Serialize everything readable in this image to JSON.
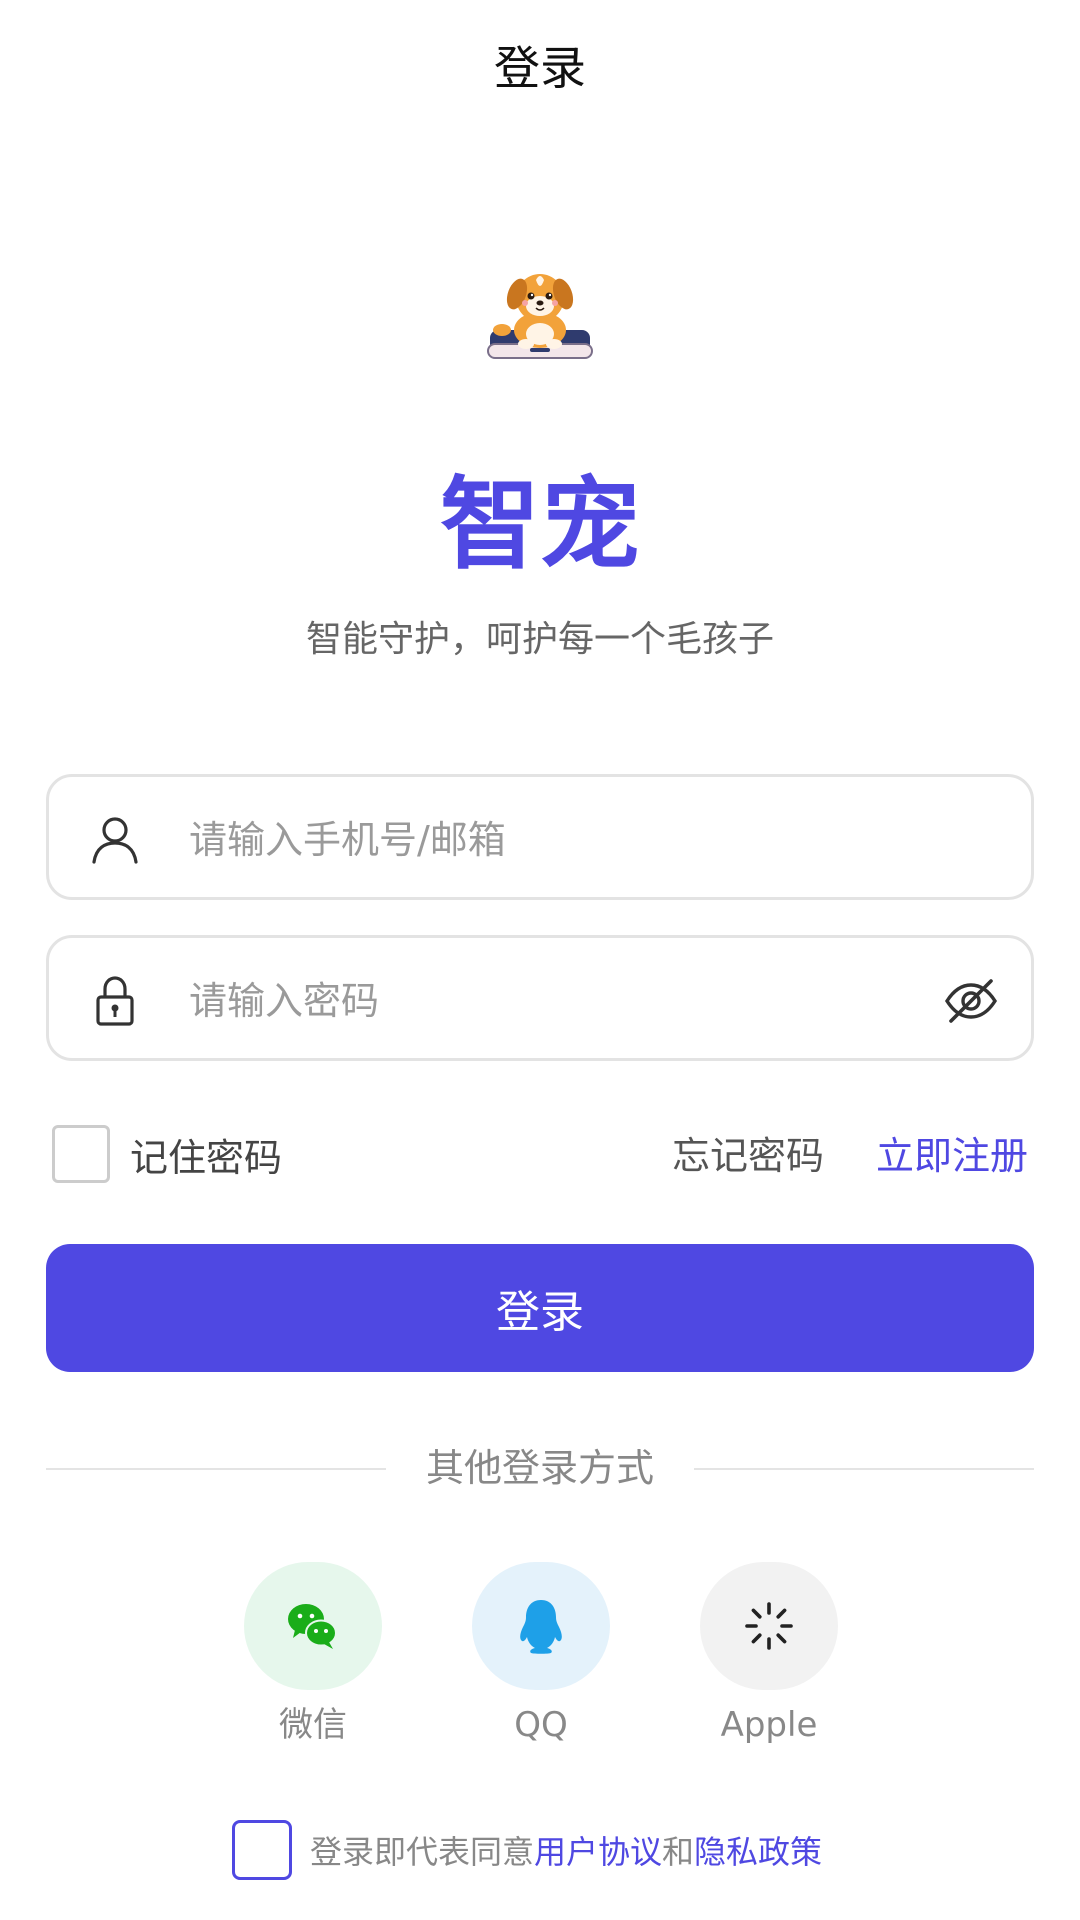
{
  "header": {
    "title": "登录"
  },
  "brand": {
    "name": "智宠",
    "slogan": "智能守护，呵护每一个毛孩子",
    "logo_icon": "puppy-on-phone-logo"
  },
  "form": {
    "account_placeholder": "请输入手机号/邮箱",
    "account_value": "",
    "account_icon": "user-icon",
    "password_placeholder": "请输入密码",
    "password_value": "",
    "password_icon": "lock-icon",
    "visibility_icon": "eye-off-icon",
    "remember_label": "记住密码",
    "remember_checked": false,
    "forgot_label": "忘记密码",
    "register_label": "立即注册",
    "submit_label": "登录"
  },
  "social": {
    "divider_label": "其他登录方式",
    "providers": [
      {
        "label": "微信",
        "icon": "wechat-icon"
      },
      {
        "label": "QQ",
        "icon": "qq-icon"
      },
      {
        "label": "Apple",
        "icon": "loading-spinner-icon"
      }
    ]
  },
  "agreement": {
    "prefix": "登录即代表同意",
    "terms_label": "用户协议",
    "connector": "和",
    "privacy_label": "隐私政策",
    "checked": false
  },
  "colors": {
    "primary": "#4f48e2",
    "wechat_green": "#1aad19",
    "wechat_bg": "#e6f7ec",
    "qq_blue": "#1ea0e8",
    "qq_bg": "#e4f2fb",
    "apple_bg": "#f2f2f2"
  }
}
